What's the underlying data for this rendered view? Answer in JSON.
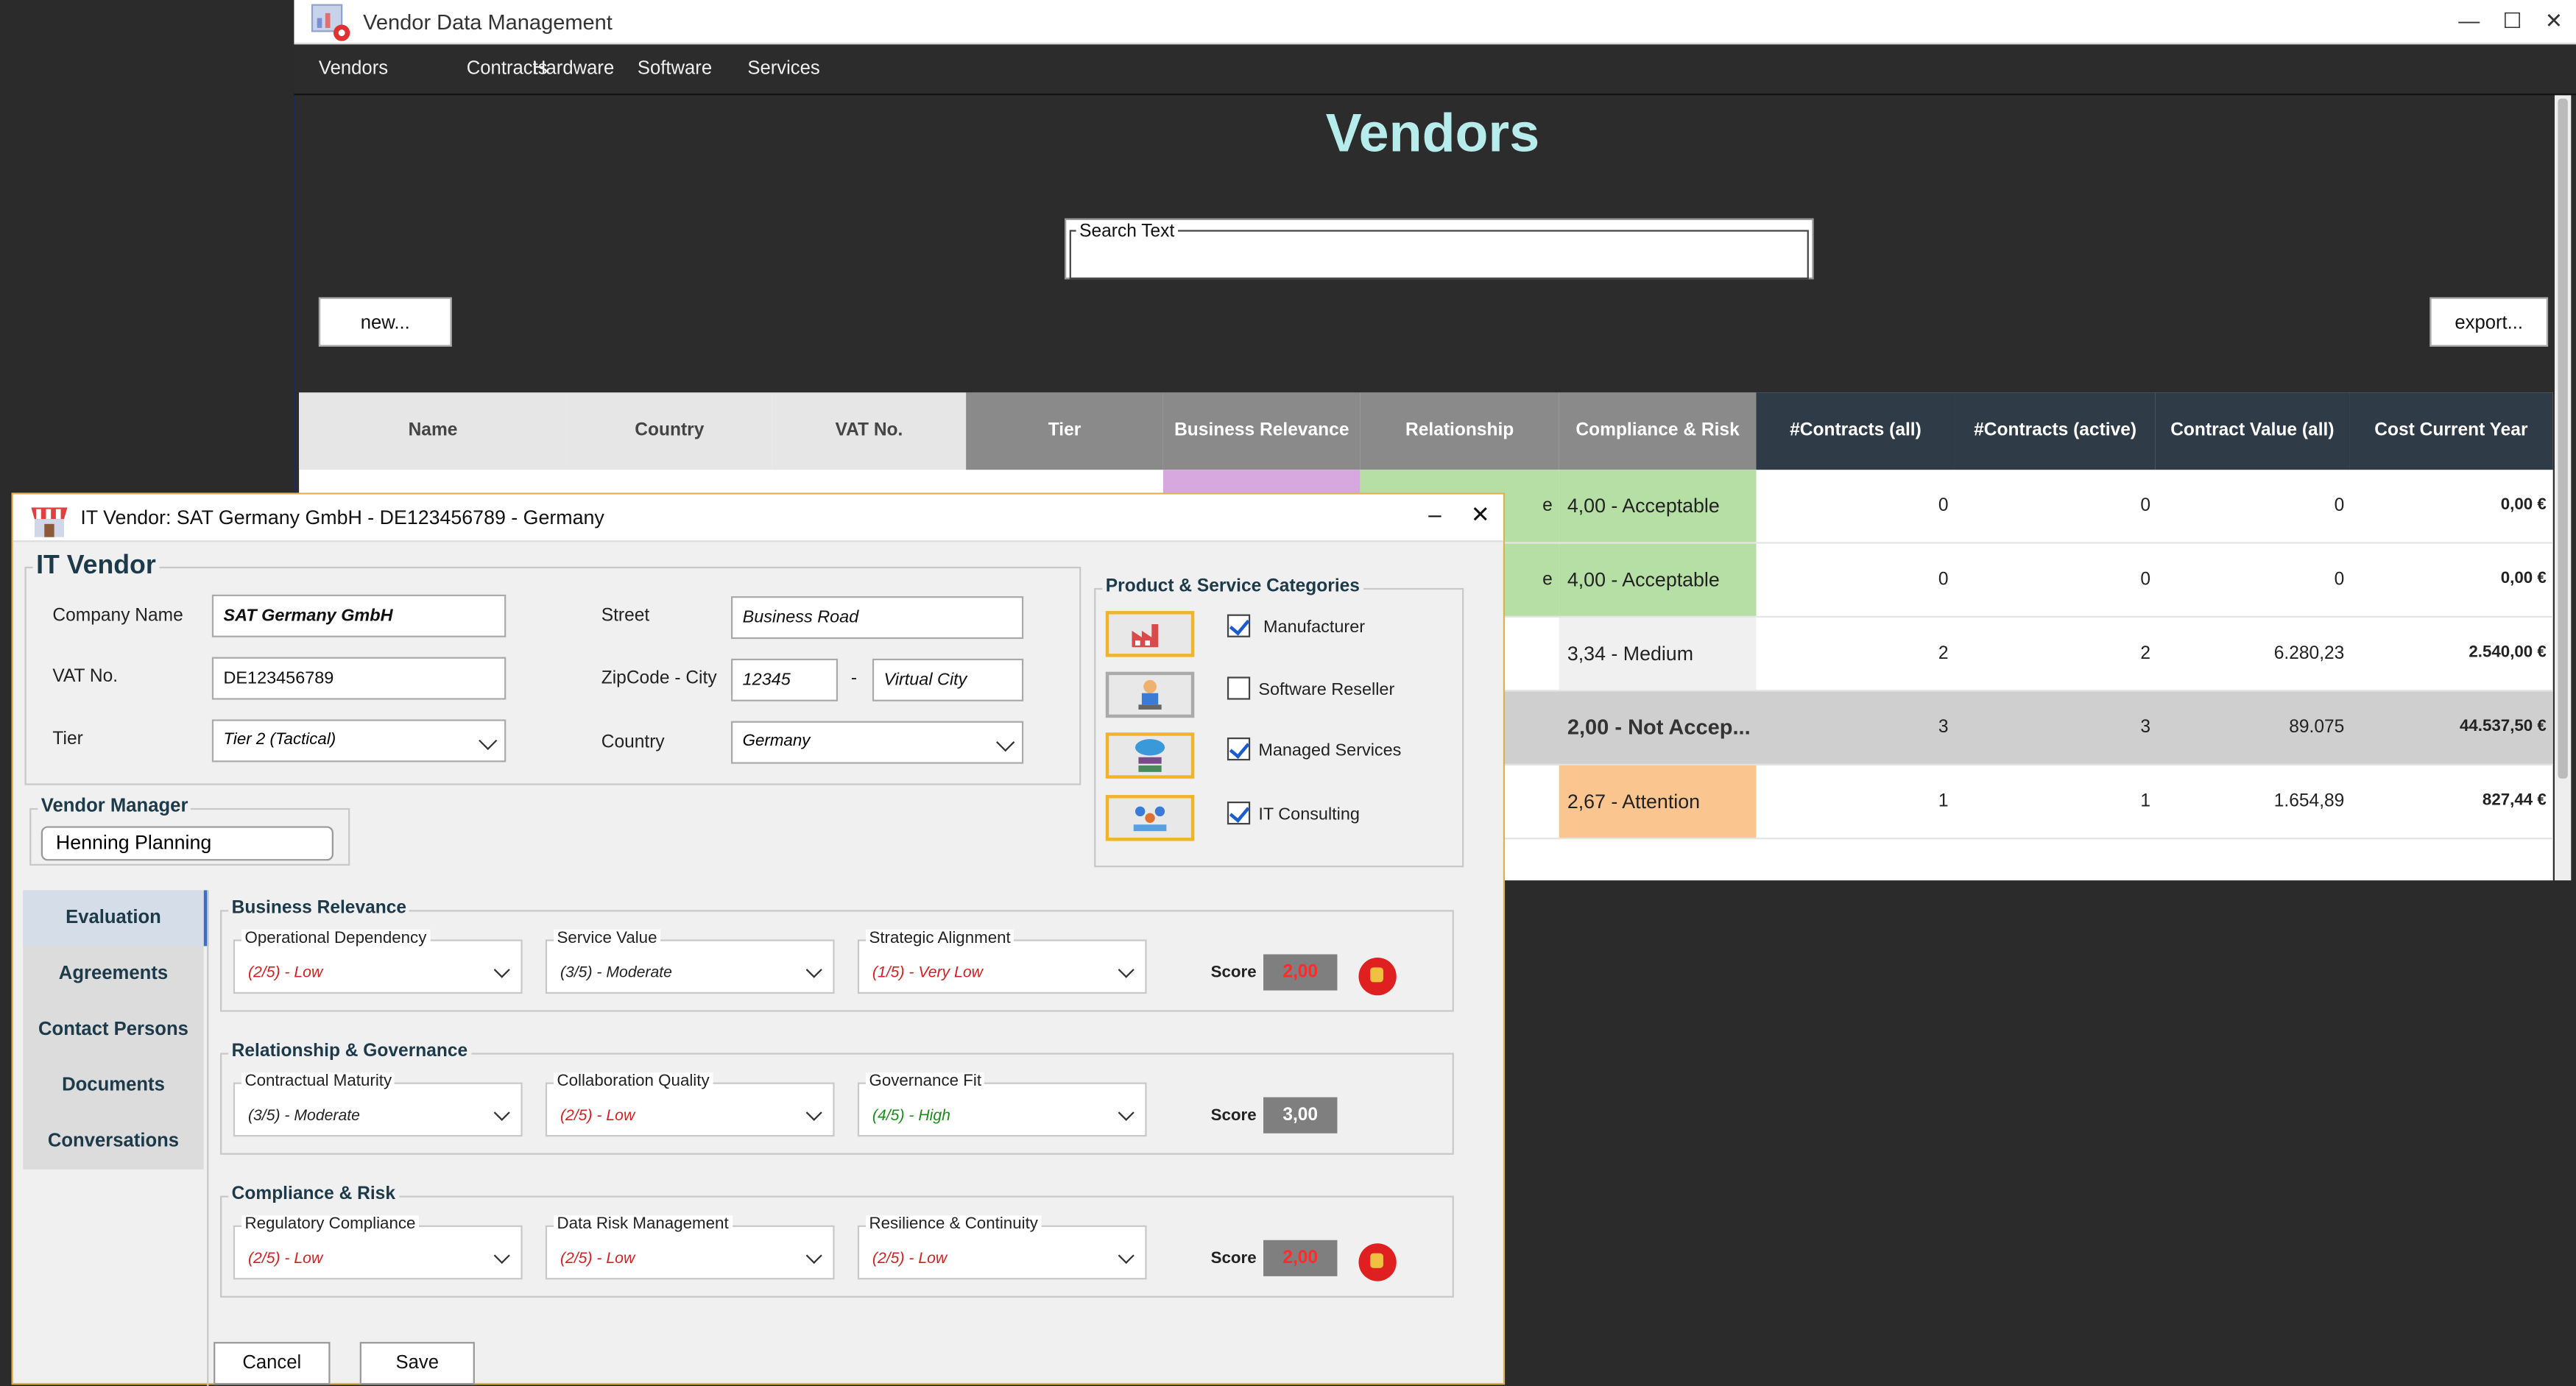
{
  "app": {
    "title": "Vendor Data Management",
    "menu": [
      "Vendors",
      "Contracts",
      "Hardware",
      "Software",
      "Services"
    ],
    "page_title": "Vendors",
    "search": {
      "legend": "Search Text",
      "value": ""
    },
    "new_label": "new...",
    "export_label": "export...",
    "columns": [
      "Name",
      "Country",
      "VAT No.",
      "Tier",
      "Business Relevance",
      "Relationship",
      "Compliance & Risk",
      "#Contracts (all)",
      "#Contracts (active)",
      "Contract Value (all)",
      "Cost Current Year"
    ],
    "rows": [
      {
        "relationship_tail": "e",
        "compliance": "4,00 - Acceptable",
        "contracts_all": "0",
        "contracts_active": "0",
        "contract_value": "0",
        "cost": "0,00 €",
        "comp_color": "#b5dfa4",
        "rel_color": "#b5dfa4",
        "bus_color": "#d7a8e0"
      },
      {
        "relationship_tail": "e",
        "compliance": "4,00 - Acceptable",
        "contracts_all": "0",
        "contracts_active": "0",
        "contract_value": "0",
        "cost": "0,00 €",
        "comp_color": "#b5dfa4",
        "rel_color": "#b5dfa4",
        "bus_color": ""
      },
      {
        "relationship_tail": "",
        "compliance": "3,34 - Medium",
        "contracts_all": "2",
        "contracts_active": "2",
        "contract_value": "6.280,23",
        "cost": "2.540,00 €",
        "comp_color": "#f0f0f0",
        "rel_color": "",
        "bus_color": ""
      },
      {
        "relationship_tail": "",
        "compliance": "2,00 - Not Accep...",
        "contracts_all": "3",
        "contracts_active": "3",
        "contract_value": "89.075",
        "cost": "44.537,50 €",
        "comp_color": "#cfcfcf",
        "rel_color": "",
        "bus_color": ""
      },
      {
        "relationship_tail": "",
        "compliance": "2,67 - Attention",
        "contracts_all": "1",
        "contracts_active": "1",
        "contract_value": "1.654,89",
        "cost": "827,44 €",
        "comp_color": "#fbc590",
        "rel_color": "",
        "bus_color": ""
      }
    ]
  },
  "dialog": {
    "title": "IT Vendor: SAT Germany GmbH  - DE123456789  - Germany",
    "section_title": "IT Vendor",
    "labels": {
      "company": "Company Name",
      "vat": "VAT No.",
      "tier": "Tier",
      "street": "Street",
      "zip": "ZipCode - City",
      "country": "Country",
      "dash": "-"
    },
    "values": {
      "company": "SAT Germany GmbH",
      "vat": "DE123456789",
      "tier": "Tier 2 (Tactical)",
      "street": "Business Road",
      "zip": "12345",
      "city": "Virtual City",
      "country": "Germany"
    },
    "vendor_manager": {
      "legend": "Vendor Manager",
      "value": "Henning Planning"
    },
    "categories": {
      "legend": "Product & Service Categories",
      "items": [
        {
          "label": "Manufacturer",
          "checked": true,
          "icon": "factory-icon"
        },
        {
          "label": "Software Reseller",
          "checked": false,
          "icon": "person-computer-icon"
        },
        {
          "label": "Managed Services",
          "checked": true,
          "icon": "cloud-server-icon"
        },
        {
          "label": "IT Consulting",
          "checked": true,
          "icon": "consulting-icon"
        }
      ]
    },
    "tabs": [
      "Evaluation",
      "Agreements",
      "Contact Persons",
      "Documents",
      "Conversations"
    ],
    "score_label": "Score",
    "groups": [
      {
        "title": "Business Relevance",
        "score": "2,00",
        "score_color": "#ff2a2a",
        "thumbs_down": true,
        "fields": [
          {
            "label": "Operational Dependency",
            "value": "(2/5) - Low",
            "level": "low"
          },
          {
            "label": "Service Value",
            "value": "(3/5) - Moderate",
            "level": "mod"
          },
          {
            "label": "Strategic Alignment",
            "value": "(1/5) - Very Low",
            "level": "vlow"
          }
        ]
      },
      {
        "title": "Relationship & Governance",
        "score": "3,00",
        "score_color": "#ffffff",
        "thumbs_down": false,
        "fields": [
          {
            "label": "Contractual Maturity",
            "value": "(3/5) - Moderate",
            "level": "mod"
          },
          {
            "label": "Collaboration Quality",
            "value": "(2/5) - Low",
            "level": "low"
          },
          {
            "label": "Governance Fit",
            "value": "(4/5) - High",
            "level": "high"
          }
        ]
      },
      {
        "title": "Compliance & Risk",
        "score": "2,00",
        "score_color": "#ff2a2a",
        "thumbs_down": true,
        "fields": [
          {
            "label": "Regulatory Compliance",
            "value": "(2/5) - Low",
            "level": "low"
          },
          {
            "label": "Data Risk Management",
            "value": "(2/5) - Low",
            "level": "low"
          },
          {
            "label": "Resilience & Continuity",
            "value": "(2/5) - Low",
            "level": "low"
          }
        ]
      }
    ],
    "cancel_label": "Cancel",
    "save_label": "Save"
  }
}
